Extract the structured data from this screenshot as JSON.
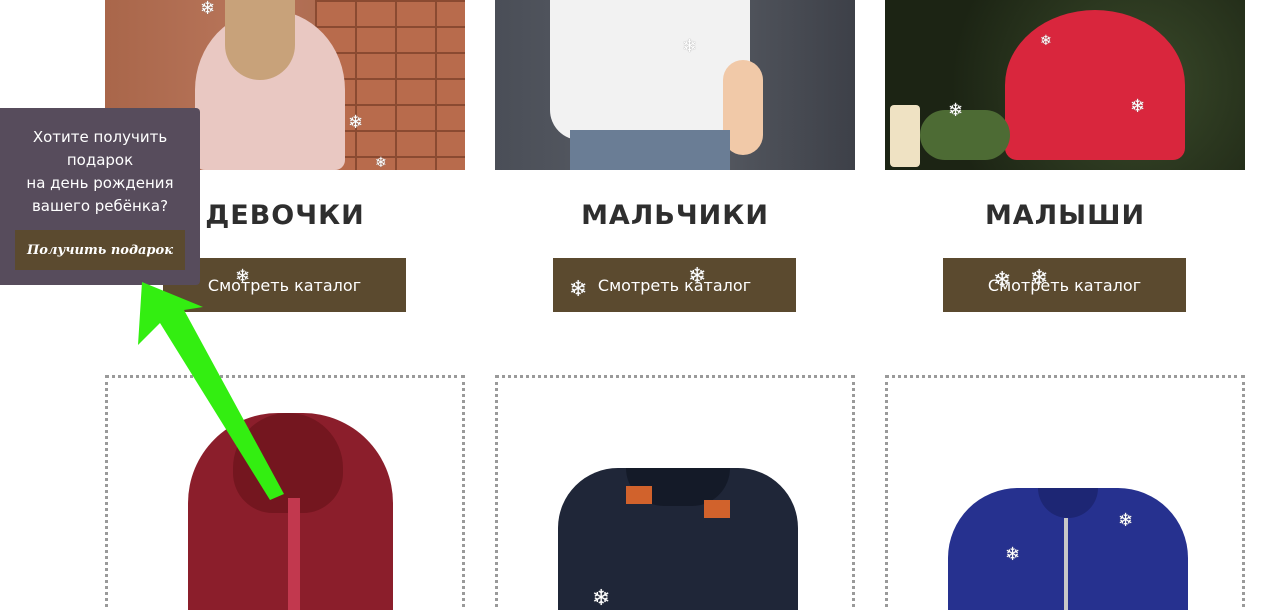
{
  "categories": [
    {
      "title": "ДЕВОЧКИ",
      "button": "Смотреть каталог"
    },
    {
      "title": "МАЛЬЧИКИ",
      "button": "Смотреть каталог"
    },
    {
      "title": "МАЛЫШИ",
      "button": "Смотреть каталог"
    }
  ],
  "gift_popup": {
    "text": "Хотите получить\nподарок\nна день рождения\nвашего ребёнка?",
    "button": "Получить подарок"
  },
  "annotation": {
    "arrow_color": "#33ee11"
  },
  "icons": {
    "snowflake": "❄"
  },
  "colors": {
    "button_bg": "#5b4a2f",
    "popup_bg": "#574c5c",
    "title_text": "#2e2e2e"
  }
}
